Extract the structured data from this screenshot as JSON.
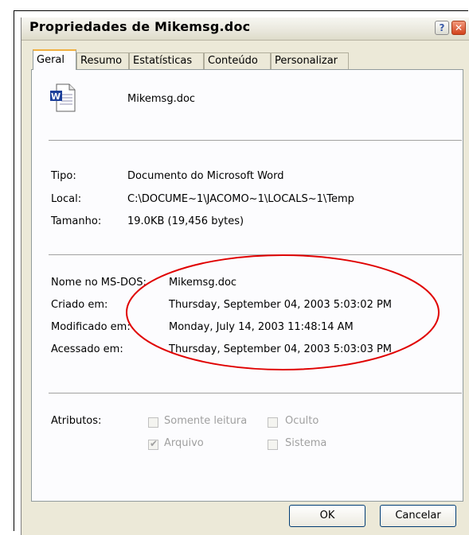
{
  "window": {
    "title": "Propriedades de Mikemsg.doc",
    "help_glyph": "?",
    "close_glyph": "✕"
  },
  "tabs": [
    {
      "label": "Geral",
      "active": true
    },
    {
      "label": "Resumo"
    },
    {
      "label": "Estatísticas"
    },
    {
      "label": "Conteúdo"
    },
    {
      "label": "Personalizar"
    }
  ],
  "file": {
    "name": "Mikemsg.doc",
    "icon": "word-document-icon"
  },
  "info": {
    "tipo_label": "Tipo:",
    "tipo_value": "Documento do Microsoft Word",
    "local_label": "Local:",
    "local_value": "C:\\DOCUME~1\\JACOMO~1\\LOCALS~1\\Temp",
    "tamanho_label": "Tamanho:",
    "tamanho_value": "19.0KB (19,456 bytes)"
  },
  "dates": {
    "msdos_label": "Nome no MS-DOS:",
    "msdos_value": "Mikemsg.doc",
    "criado_label": "Criado em:",
    "criado_value": "Thursday, September 04, 2003 5:03:02 PM",
    "modificado_label": "Modificado em:",
    "modificado_value": "Monday, July 14, 2003 11:48:14 AM",
    "acessado_label": "Acessado em:",
    "acessado_value": "Thursday, September 04, 2003 5:03:03 PM"
  },
  "attributes": {
    "label": "Atributos:",
    "somente_leitura": {
      "label": "Somente leitura",
      "checked": false
    },
    "oculto": {
      "label": "Oculto",
      "checked": false
    },
    "arquivo": {
      "label": "Arquivo",
      "checked": true
    },
    "sistema": {
      "label": "Sistema",
      "checked": false
    }
  },
  "buttons": {
    "ok": "OK",
    "cancel": "Cancelar"
  },
  "colors": {
    "highlight_ellipse": "#e00000",
    "active_tab_accent": "#f0b040"
  }
}
